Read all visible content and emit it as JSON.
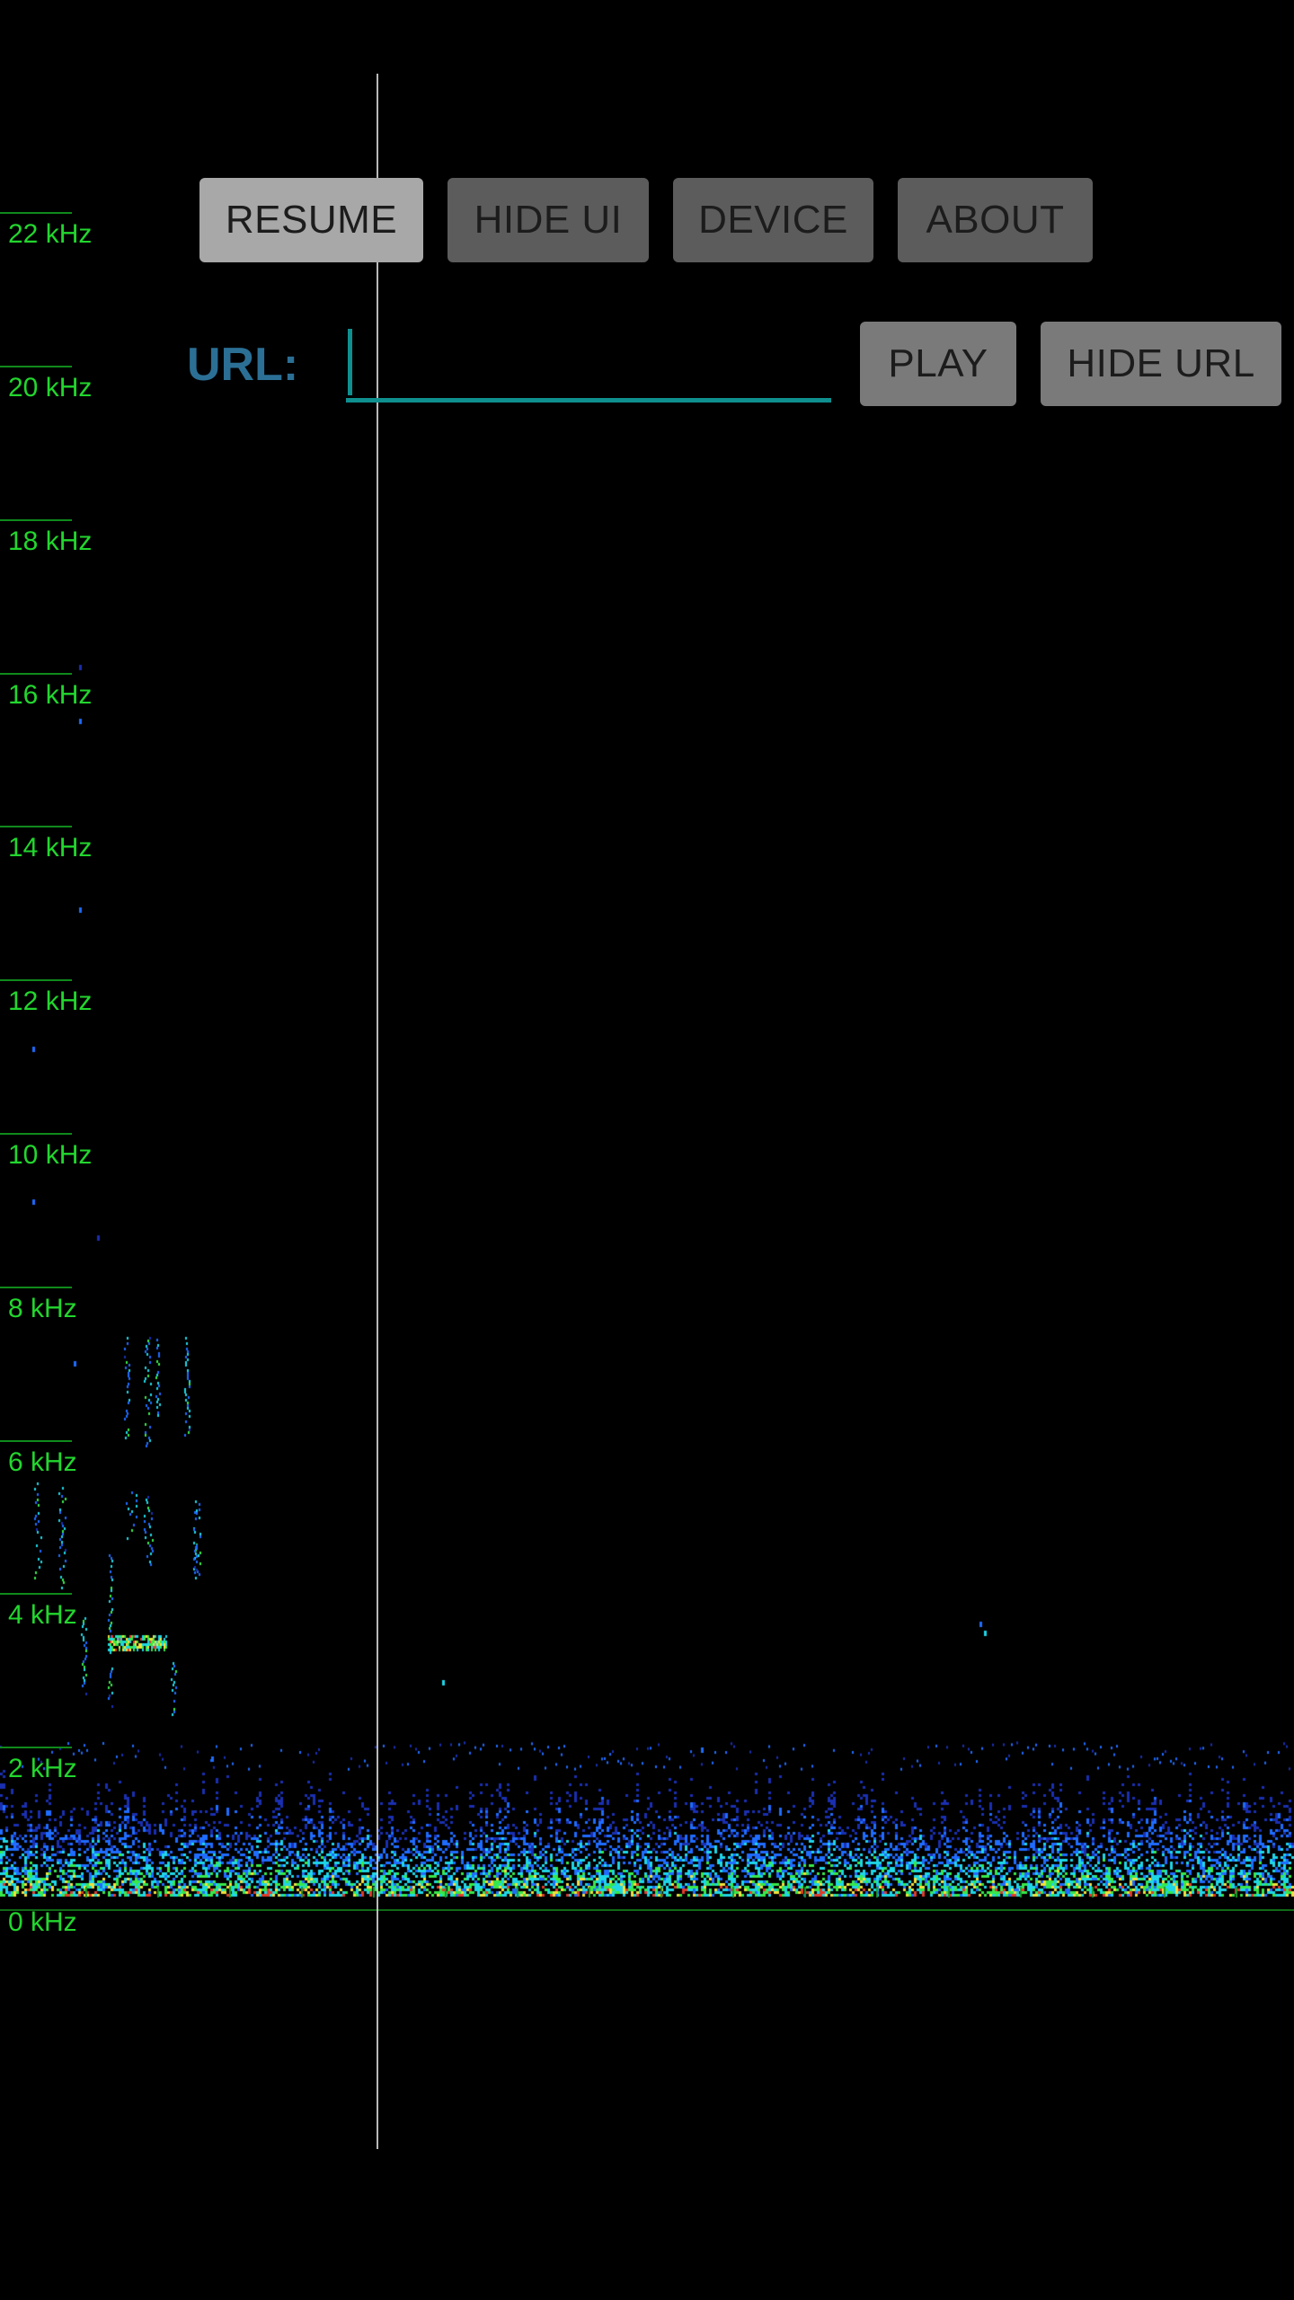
{
  "toolbar": {
    "resume_label": "RESUME",
    "hide_ui_label": "HIDE UI",
    "device_label": "DEVICE",
    "about_label": "ABOUT"
  },
  "url_bar": {
    "label": "URL:",
    "value": "",
    "play_label": "PLAY",
    "hide_url_label": "HIDE URL"
  },
  "frequency_axis": {
    "labels": [
      "22 kHz",
      "20 kHz",
      "18 kHz",
      "16 kHz",
      "14 kHz",
      "12 kHz",
      "10 kHz",
      "8 kHz",
      "6 kHz",
      "4 kHz",
      "2 kHz",
      "0 kHz"
    ]
  },
  "colors": {
    "background": "#000000",
    "axis_label": "#22d62e",
    "url_label": "#2b6f95",
    "input_underline": "#0f8f8f"
  }
}
